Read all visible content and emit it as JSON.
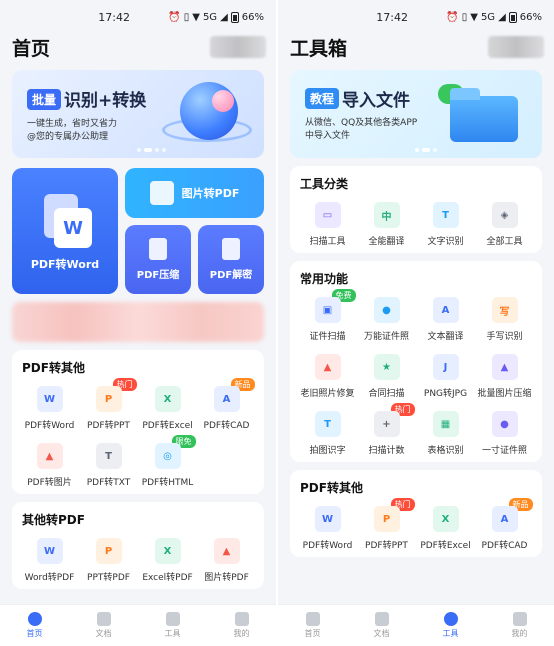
{
  "status": {
    "time": "17:42",
    "battery": "66%",
    "network": "5G"
  },
  "left": {
    "title": "首页",
    "banner": {
      "tag": "批量",
      "headline": "识别+转换",
      "line1": "一键生成，省时又省力",
      "line2": "@您的专属办公助理"
    },
    "feature": {
      "pdf_to_word": "PDF转Word",
      "image_to_pdf": "图片转PDF",
      "pdf_compress": "PDF压缩",
      "pdf_decrypt": "PDF解密"
    },
    "section1": {
      "title": "PDF转其他",
      "items": [
        {
          "label": "PDF转Word",
          "badge": ""
        },
        {
          "label": "PDF转PPT",
          "badge": "热门"
        },
        {
          "label": "PDF转Excel",
          "badge": ""
        },
        {
          "label": "PDF转CAD",
          "badge": "新品"
        },
        {
          "label": "PDF转图片",
          "badge": ""
        },
        {
          "label": "PDF转TXT",
          "badge": ""
        },
        {
          "label": "PDF转HTML",
          "badge": "限免"
        }
      ]
    },
    "section2": {
      "title": "其他转PDF",
      "items": [
        {
          "label": "Word转PDF"
        },
        {
          "label": "PPT转PDF"
        },
        {
          "label": "Excel转PDF"
        },
        {
          "label": "图片转PDF"
        }
      ]
    }
  },
  "right": {
    "title": "工具箱",
    "banner": {
      "tag": "教程",
      "headline": "导入文件",
      "line1": "从微信、QQ及其他各类APP",
      "line2": "中导入文件"
    },
    "category": {
      "title": "工具分类",
      "items": [
        "扫描工具",
        "全能翻译",
        "文字识别",
        "全部工具"
      ]
    },
    "common": {
      "title": "常用功能",
      "items": [
        {
          "label": "证件扫描",
          "badge": "免费"
        },
        {
          "label": "万能证件照",
          "badge": ""
        },
        {
          "label": "文本翻译",
          "badge": ""
        },
        {
          "label": "手写识别",
          "badge": ""
        },
        {
          "label": "老旧照片修复",
          "badge": ""
        },
        {
          "label": "合同扫描",
          "badge": ""
        },
        {
          "label": "PNG转JPG",
          "badge": ""
        },
        {
          "label": "批量图片压缩",
          "badge": ""
        },
        {
          "label": "拍图识字",
          "badge": ""
        },
        {
          "label": "扫描计数",
          "badge": "热门"
        },
        {
          "label": "表格识别",
          "badge": ""
        },
        {
          "label": "一寸证件照",
          "badge": ""
        }
      ]
    },
    "pdf_other": {
      "title": "PDF转其他",
      "items": [
        {
          "label": "PDF转Word",
          "badge": ""
        },
        {
          "label": "PDF转PPT",
          "badge": "热门"
        },
        {
          "label": "PDF转Excel",
          "badge": ""
        },
        {
          "label": "PDF转CAD",
          "badge": "新品"
        }
      ]
    }
  },
  "tabbar": {
    "home": "首页",
    "docs": "文档",
    "tools": "工具",
    "mine": "我的"
  }
}
